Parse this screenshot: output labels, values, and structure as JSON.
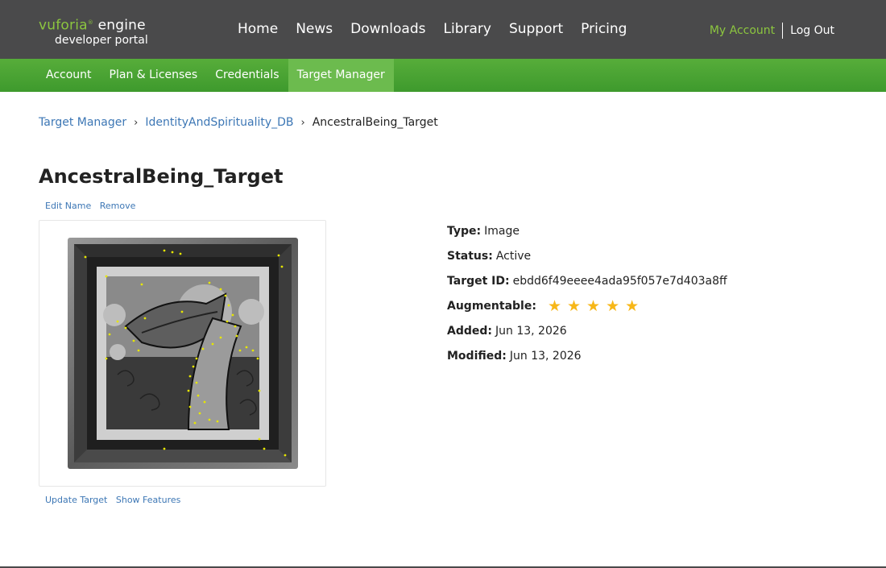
{
  "logo": {
    "brand": "vuforia",
    "engine": "engine",
    "subtitle": "developer portal"
  },
  "mainnav": {
    "items": [
      "Home",
      "News",
      "Downloads",
      "Library",
      "Support",
      "Pricing"
    ]
  },
  "account": {
    "my_account": "My Account",
    "log_out": "Log Out"
  },
  "subnav": {
    "items": [
      "Account",
      "Plan & Licenses",
      "Credentials",
      "Target Manager"
    ],
    "active": "Target Manager"
  },
  "breadcrumb": {
    "items": [
      "Target Manager",
      "IdentityAndSpirituality_DB",
      "AncestralBeing_Target"
    ],
    "separator": "›"
  },
  "target": {
    "name": "AncestralBeing_Target",
    "edit_name": "Edit Name",
    "remove": "Remove",
    "update_target": "Update Target",
    "show_features": "Show Features"
  },
  "details": {
    "type_label": "Type:",
    "type_value": "Image",
    "status_label": "Status:",
    "status_value": "Active",
    "target_id_label": "Target ID:",
    "target_id_value": "ebdd6f49eeee4ada95f057e7d403a8ff",
    "augmentable_label": "Augmentable:",
    "augmentable_rating": 5,
    "augmentable_max": 5,
    "added_label": "Added:",
    "added_value": "Jun 13, 2026",
    "modified_label": "Modified:",
    "modified_value": "Jun 13, 2026"
  },
  "colors": {
    "header": "#4a4a4b",
    "subnav": "#4ea535",
    "link": "#3d77b5",
    "accent": "#8cc63f",
    "star": "#f7b718"
  }
}
